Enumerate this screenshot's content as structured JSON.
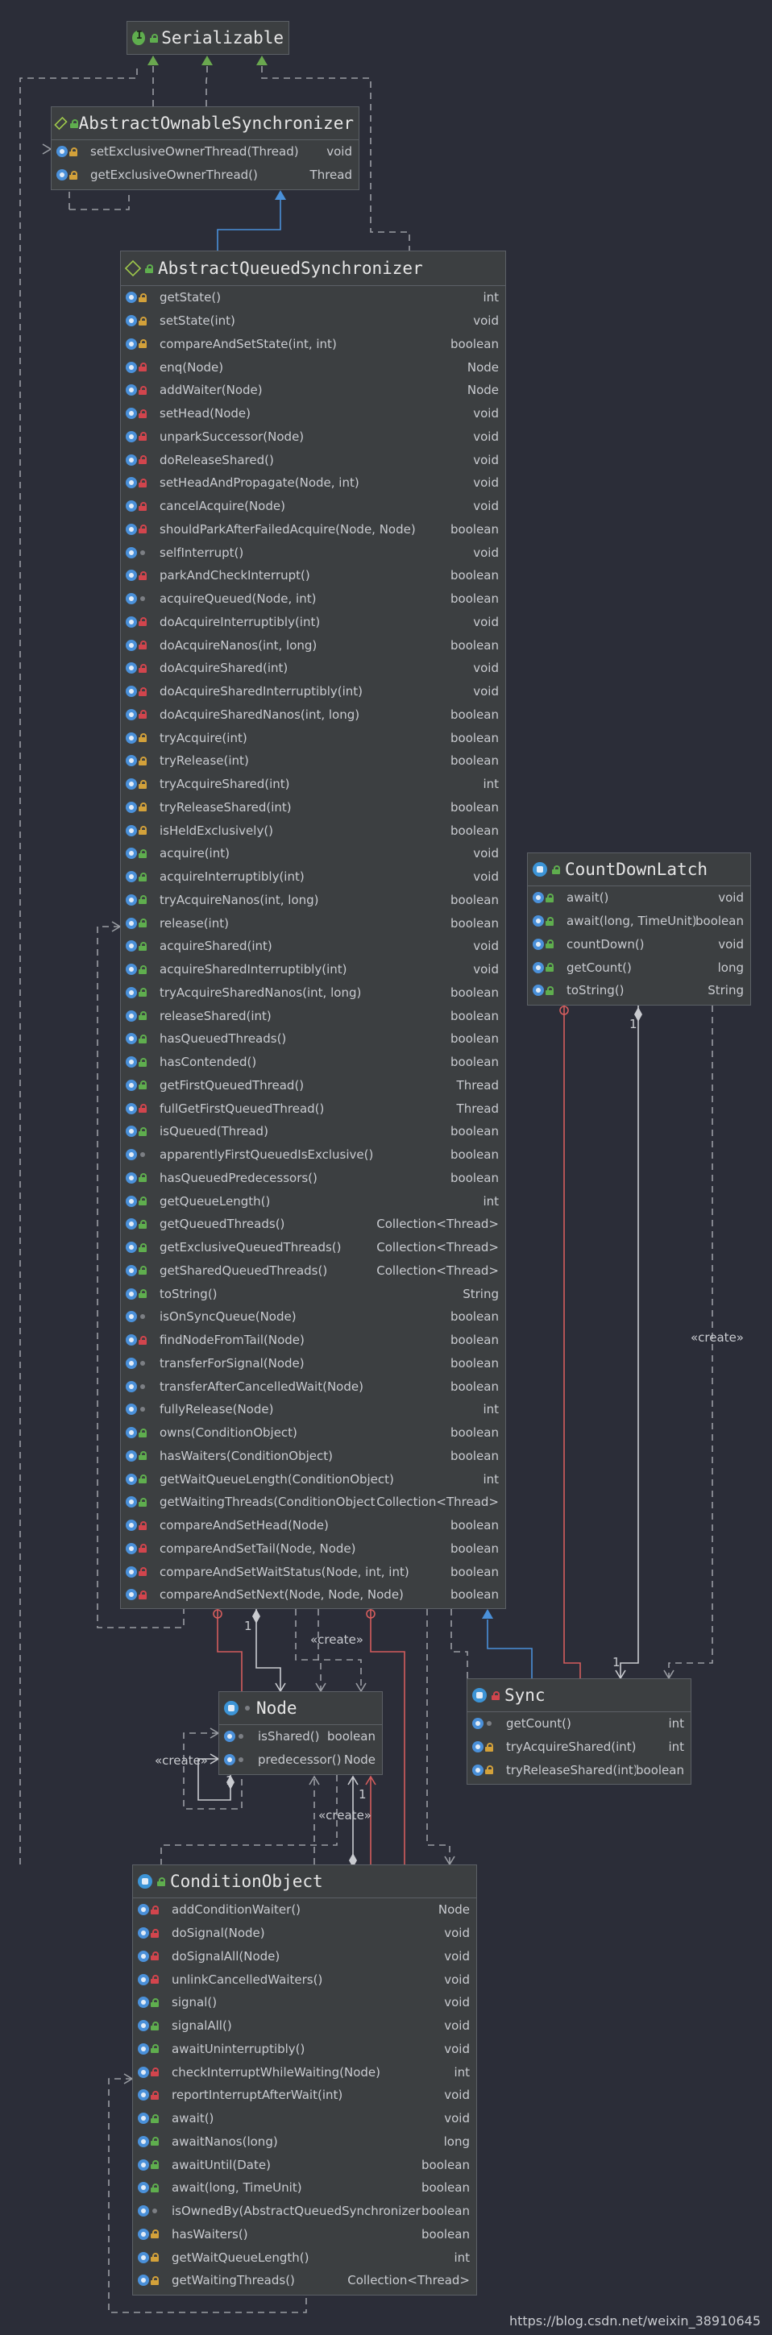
{
  "serializable": {
    "name": "Serializable"
  },
  "aos": {
    "name": "AbstractOwnableSynchronizer",
    "methods": [
      {
        "sig": "setExclusiveOwnerThread(Thread)",
        "ret": "void",
        "vis": "protected"
      },
      {
        "sig": "getExclusiveOwnerThread()",
        "ret": "Thread",
        "vis": "protected"
      }
    ]
  },
  "aqs": {
    "name": "AbstractQueuedSynchronizer",
    "methods": [
      {
        "sig": "getState()",
        "ret": "int",
        "vis": "protected"
      },
      {
        "sig": "setState(int)",
        "ret": "void",
        "vis": "protected"
      },
      {
        "sig": "compareAndSetState(int, int)",
        "ret": "boolean",
        "vis": "protected"
      },
      {
        "sig": "enq(Node)",
        "ret": "Node",
        "vis": "private"
      },
      {
        "sig": "addWaiter(Node)",
        "ret": "Node",
        "vis": "private"
      },
      {
        "sig": "setHead(Node)",
        "ret": "void",
        "vis": "private"
      },
      {
        "sig": "unparkSuccessor(Node)",
        "ret": "void",
        "vis": "private"
      },
      {
        "sig": "doReleaseShared()",
        "ret": "void",
        "vis": "private"
      },
      {
        "sig": "setHeadAndPropagate(Node, int)",
        "ret": "void",
        "vis": "private"
      },
      {
        "sig": "cancelAcquire(Node)",
        "ret": "void",
        "vis": "private"
      },
      {
        "sig": "shouldParkAfterFailedAcquire(Node, Node)",
        "ret": "boolean",
        "vis": "private"
      },
      {
        "sig": "selfInterrupt()",
        "ret": "void",
        "vis": "package"
      },
      {
        "sig": "parkAndCheckInterrupt()",
        "ret": "boolean",
        "vis": "private"
      },
      {
        "sig": "acquireQueued(Node, int)",
        "ret": "boolean",
        "vis": "package"
      },
      {
        "sig": "doAcquireInterruptibly(int)",
        "ret": "void",
        "vis": "private"
      },
      {
        "sig": "doAcquireNanos(int, long)",
        "ret": "boolean",
        "vis": "private"
      },
      {
        "sig": "doAcquireShared(int)",
        "ret": "void",
        "vis": "private"
      },
      {
        "sig": "doAcquireSharedInterruptibly(int)",
        "ret": "void",
        "vis": "private"
      },
      {
        "sig": "doAcquireSharedNanos(int, long)",
        "ret": "boolean",
        "vis": "private"
      },
      {
        "sig": "tryAcquire(int)",
        "ret": "boolean",
        "vis": "protected"
      },
      {
        "sig": "tryRelease(int)",
        "ret": "boolean",
        "vis": "protected"
      },
      {
        "sig": "tryAcquireShared(int)",
        "ret": "int",
        "vis": "protected"
      },
      {
        "sig": "tryReleaseShared(int)",
        "ret": "boolean",
        "vis": "protected"
      },
      {
        "sig": "isHeldExclusively()",
        "ret": "boolean",
        "vis": "protected"
      },
      {
        "sig": "acquire(int)",
        "ret": "void",
        "vis": "public"
      },
      {
        "sig": "acquireInterruptibly(int)",
        "ret": "void",
        "vis": "public"
      },
      {
        "sig": "tryAcquireNanos(int, long)",
        "ret": "boolean",
        "vis": "public"
      },
      {
        "sig": "release(int)",
        "ret": "boolean",
        "vis": "public"
      },
      {
        "sig": "acquireShared(int)",
        "ret": "void",
        "vis": "public"
      },
      {
        "sig": "acquireSharedInterruptibly(int)",
        "ret": "void",
        "vis": "public"
      },
      {
        "sig": "tryAcquireSharedNanos(int, long)",
        "ret": "boolean",
        "vis": "public"
      },
      {
        "sig": "releaseShared(int)",
        "ret": "boolean",
        "vis": "public"
      },
      {
        "sig": "hasQueuedThreads()",
        "ret": "boolean",
        "vis": "public"
      },
      {
        "sig": "hasContended()",
        "ret": "boolean",
        "vis": "public"
      },
      {
        "sig": "getFirstQueuedThread()",
        "ret": "Thread",
        "vis": "public"
      },
      {
        "sig": "fullGetFirstQueuedThread()",
        "ret": "Thread",
        "vis": "private"
      },
      {
        "sig": "isQueued(Thread)",
        "ret": "boolean",
        "vis": "public"
      },
      {
        "sig": "apparentlyFirstQueuedIsExclusive()",
        "ret": "boolean",
        "vis": "package"
      },
      {
        "sig": "hasQueuedPredecessors()",
        "ret": "boolean",
        "vis": "public"
      },
      {
        "sig": "getQueueLength()",
        "ret": "int",
        "vis": "public"
      },
      {
        "sig": "getQueuedThreads()",
        "ret": "Collection<Thread>",
        "vis": "public"
      },
      {
        "sig": "getExclusiveQueuedThreads()",
        "ret": "Collection<Thread>",
        "vis": "public"
      },
      {
        "sig": "getSharedQueuedThreads()",
        "ret": "Collection<Thread>",
        "vis": "public"
      },
      {
        "sig": "toString()",
        "ret": "String",
        "vis": "public"
      },
      {
        "sig": "isOnSyncQueue(Node)",
        "ret": "boolean",
        "vis": "package"
      },
      {
        "sig": "findNodeFromTail(Node)",
        "ret": "boolean",
        "vis": "private"
      },
      {
        "sig": "transferForSignal(Node)",
        "ret": "boolean",
        "vis": "package"
      },
      {
        "sig": "transferAfterCancelledWait(Node)",
        "ret": "boolean",
        "vis": "package"
      },
      {
        "sig": "fullyRelease(Node)",
        "ret": "int",
        "vis": "package"
      },
      {
        "sig": "owns(ConditionObject)",
        "ret": "boolean",
        "vis": "public"
      },
      {
        "sig": "hasWaiters(ConditionObject)",
        "ret": "boolean",
        "vis": "public"
      },
      {
        "sig": "getWaitQueueLength(ConditionObject)",
        "ret": "int",
        "vis": "public"
      },
      {
        "sig": "getWaitingThreads(ConditionObject)",
        "ret": "Collection<Thread>",
        "vis": "public"
      },
      {
        "sig": "compareAndSetHead(Node)",
        "ret": "boolean",
        "vis": "private"
      },
      {
        "sig": "compareAndSetTail(Node, Node)",
        "ret": "boolean",
        "vis": "private"
      },
      {
        "sig": "compareAndSetWaitStatus(Node, int, int)",
        "ret": "boolean",
        "vis": "private"
      },
      {
        "sig": "compareAndSetNext(Node, Node, Node)",
        "ret": "boolean",
        "vis": "private"
      }
    ]
  },
  "cdl": {
    "name": "CountDownLatch",
    "methods": [
      {
        "sig": "await()",
        "ret": "void",
        "vis": "public"
      },
      {
        "sig": "await(long, TimeUnit)",
        "ret": "boolean",
        "vis": "public"
      },
      {
        "sig": "countDown()",
        "ret": "void",
        "vis": "public"
      },
      {
        "sig": "getCount()",
        "ret": "long",
        "vis": "public"
      },
      {
        "sig": "toString()",
        "ret": "String",
        "vis": "public"
      }
    ]
  },
  "node": {
    "name": "Node",
    "methods": [
      {
        "sig": "isShared()",
        "ret": "boolean",
        "vis": "package"
      },
      {
        "sig": "predecessor()",
        "ret": "Node",
        "vis": "package"
      }
    ]
  },
  "sync": {
    "name": "Sync",
    "methods": [
      {
        "sig": "getCount()",
        "ret": "int",
        "vis": "package"
      },
      {
        "sig": "tryAcquireShared(int)",
        "ret": "int",
        "vis": "protected"
      },
      {
        "sig": "tryReleaseShared(int)",
        "ret": "boolean",
        "vis": "protected"
      }
    ]
  },
  "cond": {
    "name": "ConditionObject",
    "methods": [
      {
        "sig": "addConditionWaiter()",
        "ret": "Node",
        "vis": "private"
      },
      {
        "sig": "doSignal(Node)",
        "ret": "void",
        "vis": "private"
      },
      {
        "sig": "doSignalAll(Node)",
        "ret": "void",
        "vis": "private"
      },
      {
        "sig": "unlinkCancelledWaiters()",
        "ret": "void",
        "vis": "private"
      },
      {
        "sig": "signal()",
        "ret": "void",
        "vis": "public"
      },
      {
        "sig": "signalAll()",
        "ret": "void",
        "vis": "public"
      },
      {
        "sig": "awaitUninterruptibly()",
        "ret": "void",
        "vis": "public"
      },
      {
        "sig": "checkInterruptWhileWaiting(Node)",
        "ret": "int",
        "vis": "private"
      },
      {
        "sig": "reportInterruptAfterWait(int)",
        "ret": "void",
        "vis": "private"
      },
      {
        "sig": "await()",
        "ret": "void",
        "vis": "public"
      },
      {
        "sig": "awaitNanos(long)",
        "ret": "long",
        "vis": "public"
      },
      {
        "sig": "awaitUntil(Date)",
        "ret": "boolean",
        "vis": "public"
      },
      {
        "sig": "await(long, TimeUnit)",
        "ret": "boolean",
        "vis": "public"
      },
      {
        "sig": "isOwnedBy(AbstractQueuedSynchronizer)",
        "ret": "boolean",
        "vis": "package"
      },
      {
        "sig": "hasWaiters()",
        "ret": "boolean",
        "vis": "protected"
      },
      {
        "sig": "getWaitQueueLength()",
        "ret": "int",
        "vis": "protected"
      },
      {
        "sig": "getWaitingThreads()",
        "ret": "Collection<Thread>",
        "vis": "protected"
      }
    ]
  },
  "labels": {
    "create": "«create»",
    "one": "1"
  },
  "colors": {
    "inherit": "#4a90d9",
    "dashed": "#9a9da3",
    "composition": "#d45d5d",
    "interface_arrow": "#6aa84f"
  },
  "footer": "https://blog.csdn.net/weixin_38910645"
}
